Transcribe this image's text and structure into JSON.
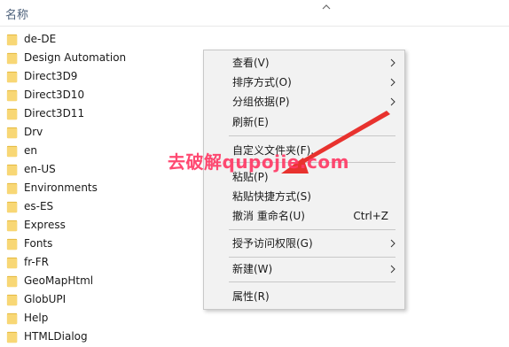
{
  "header": {
    "name_column_label": "名称"
  },
  "files": [
    {
      "name": "de-DE"
    },
    {
      "name": "Design Automation"
    },
    {
      "name": "Direct3D9"
    },
    {
      "name": "Direct3D10"
    },
    {
      "name": "Direct3D11"
    },
    {
      "name": "Drv"
    },
    {
      "name": "en"
    },
    {
      "name": "en-US"
    },
    {
      "name": "Environments"
    },
    {
      "name": "es-ES"
    },
    {
      "name": "Express"
    },
    {
      "name": "Fonts"
    },
    {
      "name": "fr-FR"
    },
    {
      "name": "GeoMapHtml"
    },
    {
      "name": "GlobUPI"
    },
    {
      "name": "Help"
    },
    {
      "name": "HTMLDialog"
    }
  ],
  "context_menu": {
    "view": "查看(V)",
    "sort_by": "排序方式(O)",
    "group_by": "分组依据(P)",
    "refresh": "刷新(E)",
    "customize_folder": "自定义文件夹(F)...",
    "paste": "粘贴(P)",
    "paste_shortcut": "粘贴快捷方式(S)",
    "undo_rename": "撤消 重命名(U)",
    "undo_shortcut": "Ctrl+Z",
    "give_access": "授予访问权限(G)",
    "new": "新建(W)",
    "properties": "属性(R)"
  },
  "watermark": {
    "text": "去破解qupojie.com"
  },
  "colors": {
    "folder_yellow": "#f8d775",
    "folder_dark": "#e4b93f",
    "arrow_red": "#e8322e",
    "watermark_pink": "#ff3a66"
  },
  "icons": {
    "folder": "folder-icon",
    "chevron": "chevron-up-icon",
    "submenu": "chevron-right-icon"
  }
}
